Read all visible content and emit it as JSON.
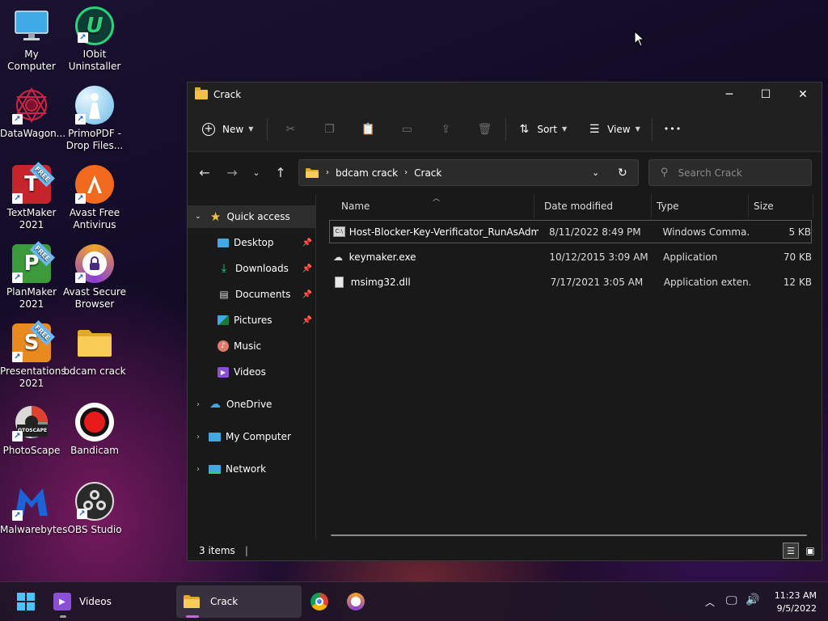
{
  "desktop": {
    "icons": [
      {
        "label": "My Computer",
        "icon": "computer-icon"
      },
      {
        "label": "IObit Uninstaller",
        "icon": "iobit-icon"
      },
      {
        "label": "DataWagon...",
        "icon": "datawagon-icon"
      },
      {
        "label": "PrimoPDF - Drop Files...",
        "icon": "primopdf-icon"
      },
      {
        "label": "TextMaker 2021",
        "icon": "textmaker-icon"
      },
      {
        "label": "Avast Free Antivirus",
        "icon": "avast-icon"
      },
      {
        "label": "PlanMaker 2021",
        "icon": "planmaker-icon"
      },
      {
        "label": "Avast Secure Browser",
        "icon": "avast-browser-icon"
      },
      {
        "label": "Presentations 2021",
        "icon": "presentations-icon"
      },
      {
        "label": "bdcam crack",
        "icon": "folder-icon"
      },
      {
        "label": "PhotoScape",
        "icon": "photoscape-icon"
      },
      {
        "label": "Bandicam",
        "icon": "bandicam-icon"
      },
      {
        "label": "Malwarebytes",
        "icon": "malwarebytes-icon"
      },
      {
        "label": "OBS Studio",
        "icon": "obs-icon"
      }
    ],
    "free_badge": "FREE",
    "iobit_letter": "U",
    "textmaker_letter": "T",
    "planmaker_letter": "P",
    "presentations_letter": "S",
    "photoscape_letter": "OTOSCAPE"
  },
  "window": {
    "title": "Crack",
    "controls": {
      "minimize": "─",
      "maximize": "☐",
      "close": "✕"
    },
    "toolbar": {
      "new_label": "New",
      "sort_label": "Sort",
      "view_label": "View",
      "more_label": "•••"
    },
    "address": {
      "crumbs": [
        "bdcam crack",
        "Crack"
      ]
    },
    "search": {
      "placeholder": "Search Crack"
    },
    "nav": {
      "quick_access": "Quick access",
      "items": [
        {
          "label": "Desktop",
          "pinned": true
        },
        {
          "label": "Downloads",
          "pinned": true
        },
        {
          "label": "Documents",
          "pinned": true
        },
        {
          "label": "Pictures",
          "pinned": true
        },
        {
          "label": "Music",
          "pinned": false
        },
        {
          "label": "Videos",
          "pinned": false
        }
      ],
      "roots": [
        "OneDrive",
        "My Computer",
        "Network"
      ]
    },
    "columns": [
      "Name",
      "Date modified",
      "Type",
      "Size"
    ],
    "files": [
      {
        "name": "Host-Blocker-Key-Verificator_RunAsAdm...",
        "date": "8/11/2022 8:49 PM",
        "type": "Windows Comma...",
        "size": "5 KB",
        "icon": "cmd-icon"
      },
      {
        "name": "keymaker.exe",
        "date": "10/12/2015 3:09 AM",
        "type": "Application",
        "size": "70 KB",
        "icon": "exe-icon"
      },
      {
        "name": "msimg32.dll",
        "date": "7/17/2021 3:05 AM",
        "type": "Application exten...",
        "size": "12 KB",
        "icon": "dll-icon"
      }
    ],
    "status": "3 items"
  },
  "taskbar": {
    "videos_label": "Videos",
    "crack_label": "Crack",
    "time": "11:23 AM",
    "date": "9/5/2022"
  },
  "colors": {
    "accent": "#f3c14b",
    "window_bg": "#191919",
    "selected_nav": "#2d2d2d"
  }
}
